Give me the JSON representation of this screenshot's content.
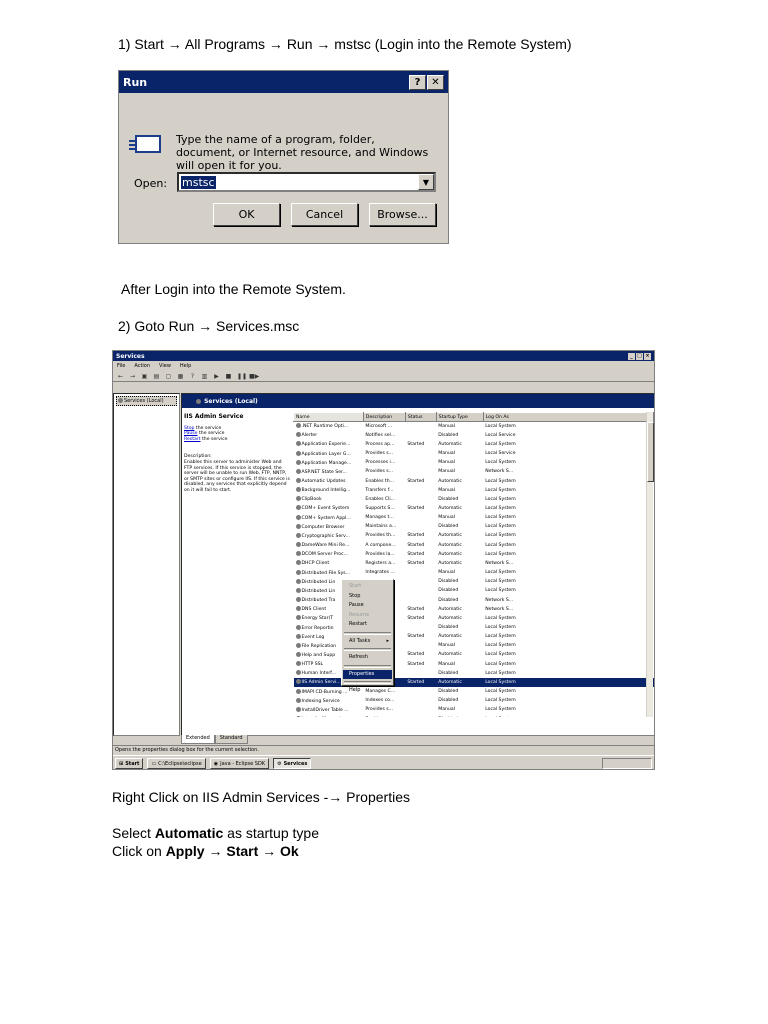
{
  "steps": {
    "step1": "1) Start → All Programs → Run → mstsc (Login into the Remote System)",
    "after_login": "After Login into the Remote System.",
    "step2": "2) Goto Run → Services.msc",
    "right_click": "Right Click on IIS Admin Services -→ Properties",
    "select_prefix": "Select ",
    "select_bold": "Automatic",
    "select_suffix": " as startup type",
    "click_prefix": "Click on ",
    "click_bold": "Apply → Start → Ok"
  },
  "run_dialog": {
    "title": "Run",
    "help_btn": "?",
    "close_btn": "✕",
    "description": "Type the name of a program, folder, document, or Internet resource, and Windows will open it for you.",
    "open_label": "Open:",
    "open_value": "mstsc",
    "ok": "OK",
    "cancel": "Cancel",
    "browse": "Browse..."
  },
  "services": {
    "title": "Services",
    "menu": [
      "File",
      "Action",
      "View",
      "Help"
    ],
    "tree_node": "Services (Local)",
    "header": "Services (Local)",
    "selected_service": "IIS Admin Service",
    "links": [
      "Stop",
      "Pause",
      "Restart"
    ],
    "link_suffix": "the service",
    "desc_title": "Description:",
    "desc_text": "Enables this server to administer Web and FTP services. If this service is stopped, the server will be unable to run Web, FTP, NNTP, or SMTP sites or configure IIS. If this service is disabled, any services that explicitly depend on it will fail to start.",
    "columns": [
      "Name",
      "Description",
      "Status",
      "Startup Type",
      "Log On As"
    ],
    "rows": [
      [
        ".NET Runtime Opti...",
        "Microsoft ...",
        "",
        "Manual",
        "Local System"
      ],
      [
        "Alerter",
        "Notifies sel...",
        "",
        "Disabled",
        "Local Service"
      ],
      [
        "Application Experie...",
        "Process ap...",
        "Started",
        "Automatic",
        "Local System"
      ],
      [
        "Application Layer G...",
        "Provides s...",
        "",
        "Manual",
        "Local Service"
      ],
      [
        "Application Manage...",
        "Processes i...",
        "",
        "Manual",
        "Local System"
      ],
      [
        "ASP.NET State Ser...",
        "Provides s...",
        "",
        "Manual",
        "Network S..."
      ],
      [
        "Automatic Updates",
        "Enables th...",
        "Started",
        "Automatic",
        "Local System"
      ],
      [
        "Background Intellig...",
        "Transfers f...",
        "",
        "Manual",
        "Local System"
      ],
      [
        "ClipBook",
        "Enables Cli...",
        "",
        "Disabled",
        "Local System"
      ],
      [
        "COM+ Event System",
        "Supports S...",
        "Started",
        "Automatic",
        "Local System"
      ],
      [
        "COM+ System Appl...",
        "Manages t...",
        "",
        "Manual",
        "Local System"
      ],
      [
        "Computer Browser",
        "Maintains a...",
        "",
        "Disabled",
        "Local System"
      ],
      [
        "Cryptographic Serv...",
        "Provides th...",
        "Started",
        "Automatic",
        "Local System"
      ],
      [
        "DameWare Mini Re...",
        "A compone...",
        "Started",
        "Automatic",
        "Local System"
      ],
      [
        "DCOM Server Proc...",
        "Provides la...",
        "Started",
        "Automatic",
        "Local System"
      ],
      [
        "DHCP Client",
        "Registers a...",
        "Started",
        "Automatic",
        "Network S..."
      ],
      [
        "Distributed File Sys...",
        "Integrates ...",
        "",
        "Manual",
        "Local System"
      ],
      [
        "Distributed Lin",
        "",
        "",
        "Disabled",
        "Local System"
      ],
      [
        "Distributed Lin",
        "",
        "",
        "Disabled",
        "Local System"
      ],
      [
        "Distributed Tra",
        "",
        "",
        "Disabled",
        "Network S..."
      ],
      [
        "DNS Client",
        "",
        "Started",
        "Automatic",
        "Network S..."
      ],
      [
        "Energy Star(T",
        "",
        "Started",
        "Automatic",
        "Local System"
      ],
      [
        "Error Reportin",
        "",
        "",
        "Disabled",
        "Local System"
      ],
      [
        "Event Log",
        "",
        "Started",
        "Automatic",
        "Local System"
      ],
      [
        "File Replication",
        "",
        "",
        "Manual",
        "Local System"
      ],
      [
        "Help and Supp",
        "",
        "Started",
        "Automatic",
        "Local System"
      ],
      [
        "HTTP SSL",
        "",
        "Started",
        "Manual",
        "Local System"
      ],
      [
        "Human Interf...",
        "",
        "",
        "Disabled",
        "Local System"
      ],
      [
        "IIS Admin Servi...",
        "Enables th...",
        "Started",
        "Automatic",
        "Local System"
      ],
      [
        "IMAPI CD-Burning ...",
        "Manages C...",
        "",
        "Disabled",
        "Local System"
      ],
      [
        "Indexing Service",
        "Indexes co...",
        "",
        "Disabled",
        "Local System"
      ],
      [
        "InstallDriver Table ...",
        "Provides s...",
        "",
        "Manual",
        "Local System"
      ],
      [
        "Intersite Messaging",
        "Enables me...",
        "",
        "Disabled",
        "Local System"
      ],
      [
        "IPSEC Services",
        "Provides e...",
        "",
        "Manual",
        "Local System"
      ]
    ],
    "highlight_row": 28,
    "tab_extended": "Extended",
    "tab_standard": "Standard",
    "status_text": "Opens the properties dialog box for the current selection.",
    "taskbar": {
      "start": "Start",
      "item1": "C:\\Eclipse\\eclipse",
      "item2": "Java - Eclipse SDK",
      "item3": "Services"
    }
  },
  "context_menu": {
    "items": [
      "Start",
      "Stop",
      "Pause",
      "Resume",
      "Restart",
      "All Tasks",
      "Refresh",
      "Properties",
      "Help"
    ]
  },
  "colors": {
    "titlebar": "#0a246a",
    "dialog_bg": "#d4d0c8"
  }
}
